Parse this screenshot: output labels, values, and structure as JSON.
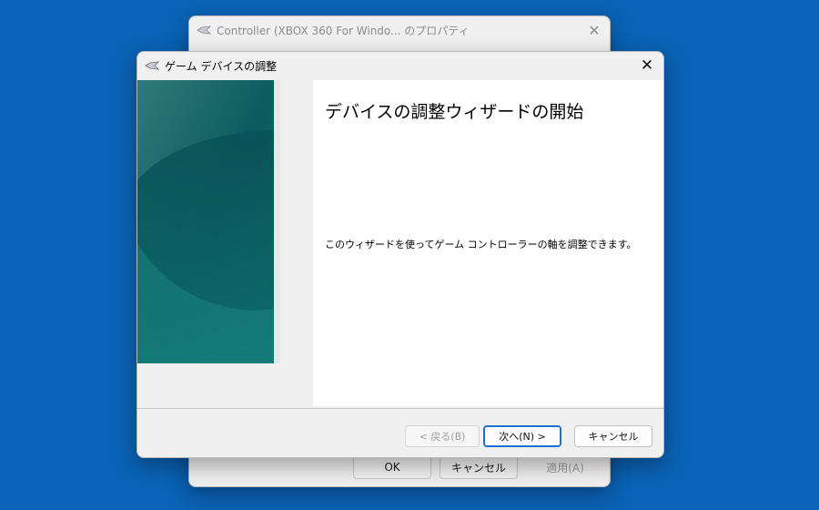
{
  "background_window": {
    "title": "Controller (XBOX 360 For Windo... のプロパティ",
    "buttons": {
      "ok": "OK",
      "cancel": "キャンセル",
      "apply": "適用(A)"
    }
  },
  "wizard": {
    "title": "ゲーム デバイスの調整",
    "heading": "デバイスの調整ウィザードの開始",
    "description": "このウィザードを使ってゲーム コントローラーの軸を調整できます。",
    "buttons": {
      "back": "< 戻る(B)",
      "next": "次へ(N) >",
      "cancel": "キャンセル"
    }
  },
  "colors": {
    "desktop": "#0a63b6",
    "art_teal": "#0e5f63",
    "primary_border": "#1d6fcf"
  },
  "icons": {
    "app": "game-controller-icon",
    "close": "close-icon"
  }
}
